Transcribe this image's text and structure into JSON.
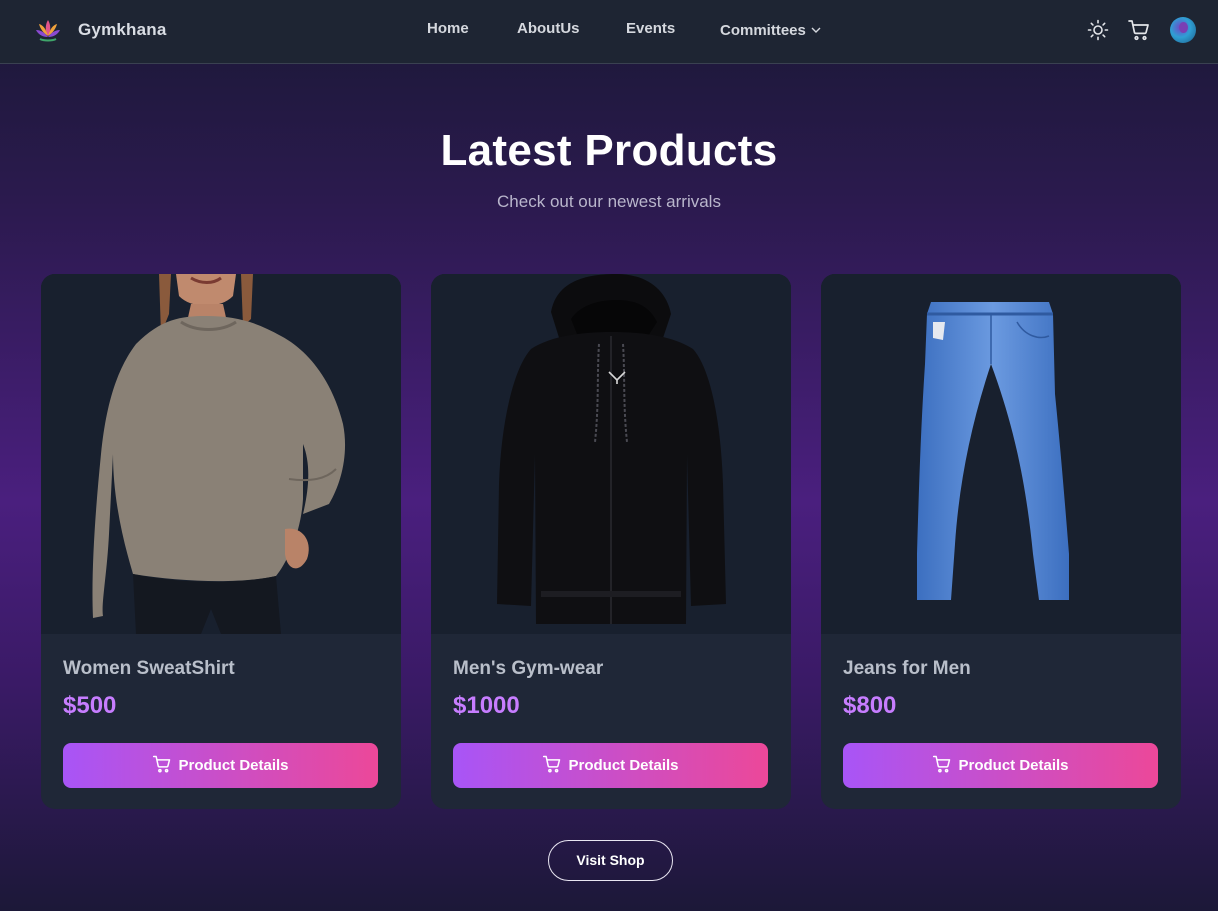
{
  "nav": {
    "brand": "Gymkhana",
    "links": [
      {
        "label": "Home"
      },
      {
        "label": "AboutUs"
      },
      {
        "label": "Events"
      },
      {
        "label": "Committees"
      }
    ],
    "icons": [
      "sun-icon",
      "cart-icon",
      "avatar"
    ]
  },
  "hero": {
    "title": "Latest Products",
    "subtitle": "Check out our newest arrivals"
  },
  "products": [
    {
      "name": "Women SweatShirt",
      "price": "$500",
      "button": "Product Details",
      "image": "sweatshirt-image"
    },
    {
      "name": "Men's Gym-wear",
      "price": "$1000",
      "button": "Product Details",
      "image": "hoodie-image"
    },
    {
      "name": "Jeans for Men",
      "price": "$800",
      "button": "Product Details",
      "image": "jeans-image"
    }
  ],
  "footer": {
    "visit_label": "Visit Shop"
  },
  "colors": {
    "accent_start": "#a855f7",
    "accent_end": "#ec4899",
    "price": "#c77dff",
    "card_bg": "#1f2737",
    "nav_bg": "#1e2533"
  }
}
